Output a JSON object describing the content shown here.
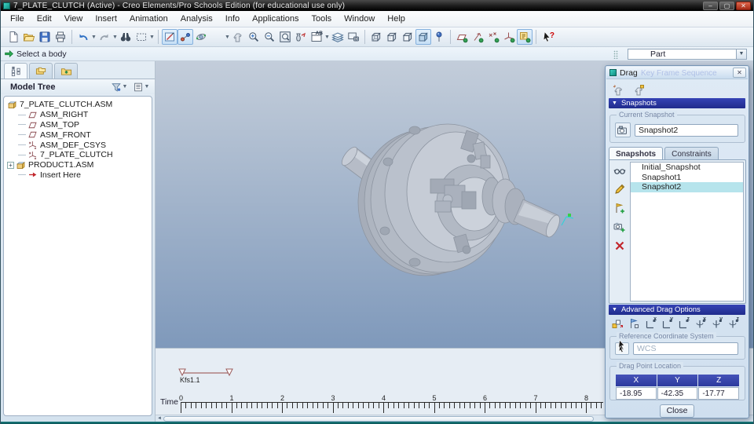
{
  "window": {
    "title": "7_PLATE_CLUTCH (Active) - Creo Elements/Pro Schools Edition (for educational use only)"
  },
  "icons": {
    "minimize": "–",
    "restore": "▢",
    "close": "✕",
    "dropdown": "▼",
    "collapse_triangle": "▼",
    "left_arrow": "◄",
    "views_label": "AB",
    "help_q": "?",
    "axis_x": "x",
    "axis_y": "y",
    "axis_z": "z",
    "plus_expand": "+"
  },
  "menu": {
    "items": [
      "File",
      "Edit",
      "View",
      "Insert",
      "Animation",
      "Analysis",
      "Info",
      "Applications",
      "Tools",
      "Window",
      "Help"
    ]
  },
  "toolbar": {
    "icon_names": [
      "new-file",
      "open",
      "save",
      "print",
      "undo",
      "redo",
      "find",
      "select-box",
      "repaint",
      "spin-center",
      "orbit",
      "shaded-sphere",
      "drag-hand",
      "zoom-in",
      "zoom-out",
      "zoom-fit",
      "reorient",
      "saved-views",
      "layers",
      "view-manager",
      "wireframe",
      "hidden-line",
      "no-hidden",
      "shading",
      "datum-point",
      "plane-display",
      "axis-display",
      "point-display",
      "csys-display",
      "annotation-display",
      "context-help"
    ]
  },
  "message_bar": {
    "prompt": "Select a body"
  },
  "mode_combo": {
    "value": "Part"
  },
  "model_tree": {
    "title": "Model Tree",
    "items": [
      {
        "label": "7_PLATE_CLUTCH.ASM"
      },
      {
        "label": "ASM_RIGHT"
      },
      {
        "label": "ASM_TOP"
      },
      {
        "label": "ASM_FRONT"
      },
      {
        "label": "ASM_DEF_CSYS"
      },
      {
        "label": "7_PLATE_CLUTCH"
      },
      {
        "label": "PRODUCT1.ASM"
      },
      {
        "label": "Insert Here"
      }
    ]
  },
  "timeline": {
    "label": "Time",
    "track_label": "Kfs1.1",
    "start": 0,
    "end": 8
  },
  "drag_dialog": {
    "title": "Drag",
    "ghost_title": "Key Frame Sequence",
    "sections": {
      "snapshots": "Snapshots",
      "advanced": "Advanced Drag Options"
    },
    "current_snapshot": {
      "label": "Current Snapshot",
      "value": "Snapshot2"
    },
    "tabs": {
      "snapshots": "Snapshots",
      "constraints": "Constraints",
      "active": "Snapshots"
    },
    "snapshot_list": [
      "Initial_Snapshot",
      "Snapshot1",
      "Snapshot2"
    ],
    "selected_snapshot": "Snapshot2",
    "reference_cs": {
      "label": "Reference Coordinate System",
      "value": "WCS"
    },
    "drag_point": {
      "label": "Drag Point Location",
      "columns": [
        "X",
        "Y",
        "Z"
      ],
      "values": [
        "-18.95",
        "-42.35",
        "-17.77"
      ]
    },
    "close_label": "Close"
  },
  "colors": {
    "header_navy": "#2b35a3",
    "selection_cyan": "#b6e4ec",
    "viewport_top": "#c3cdda",
    "viewport_bottom": "#7f99bb",
    "accent_blue": "#2d6fc4",
    "teal_strip": "#0b5456"
  }
}
